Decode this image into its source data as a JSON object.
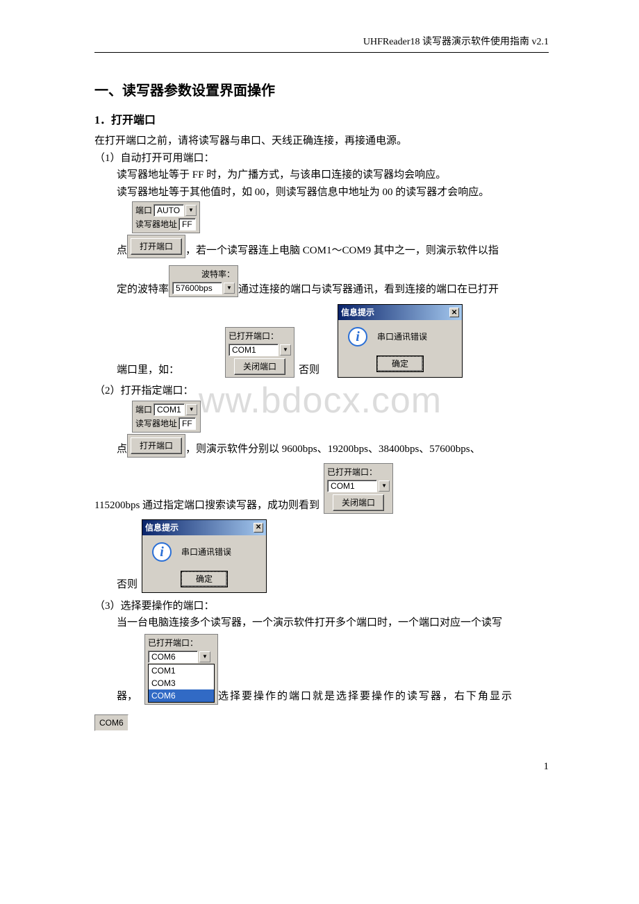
{
  "header": {
    "doc_title": "UHFReader18 读写器演示软件使用指南 v2.1"
  },
  "section1": {
    "title": "一、读写器参数设置界面操作",
    "sub1": {
      "title": "1．打开端口",
      "p_intro": "在打开端口之前，请将读写器与串口、天线正确连接，再接通电源。",
      "item1_label": "（1）自动打开可用端口：",
      "item1_l1": "读写器地址等于 FF 时，为广播方式，与该串口连接的读写器均会响应。",
      "item1_l2": "读写器地址等于其他值时，如 00，则读写器信息中地址为 00 的读写器才会响应。",
      "row_click_prefix": "点",
      "row_click_suffix": "，若一个读写器连上电脑 COM1～COM9 其中之一，则演示软件以指",
      "row_baud_prefix": "定的波特率",
      "row_baud_suffix": "通过连接的端口与读写器通讯，看到连接的端口在已打开",
      "row_open_prefix": "端口里，如：",
      "row_open_suffix": "否则",
      "item2_label": "（2）打开指定端口：",
      "row2_click_suffix": "，则演示软件分别以 9600bps、19200bps、38400bps、57600bps、",
      "row2_line2_prefix": "115200bps 通过指定端口搜索读写器，成功则看到",
      "row2_else": "否则",
      "item3_label": "（3）选择要操作的端口：",
      "item3_l1": "当一台电脑连接多个读写器，一个演示软件打开多个端口时，一个端口对应一个读写",
      "item3_l2_prefix": "器，",
      "item3_l2_suffix": "选择要操作的端口就是选择要操作的读写器，右下角显示"
    }
  },
  "ui": {
    "port_label": "端口",
    "addr_label": "读写器地址",
    "open_btn": "打开端口",
    "close_btn": "关闭端口",
    "baud_label": "波特率：",
    "opened_label": "已打开端口：",
    "auto": "AUTO",
    "com1": "COM1",
    "com3": "COM3",
    "com6": "COM6",
    "ff": "FF",
    "baud_value": "57600bps"
  },
  "dialog": {
    "title": "信息提示",
    "msg": "串口通讯错误",
    "ok": "确定"
  },
  "watermark": "ww.bdocx.com",
  "page": "1"
}
